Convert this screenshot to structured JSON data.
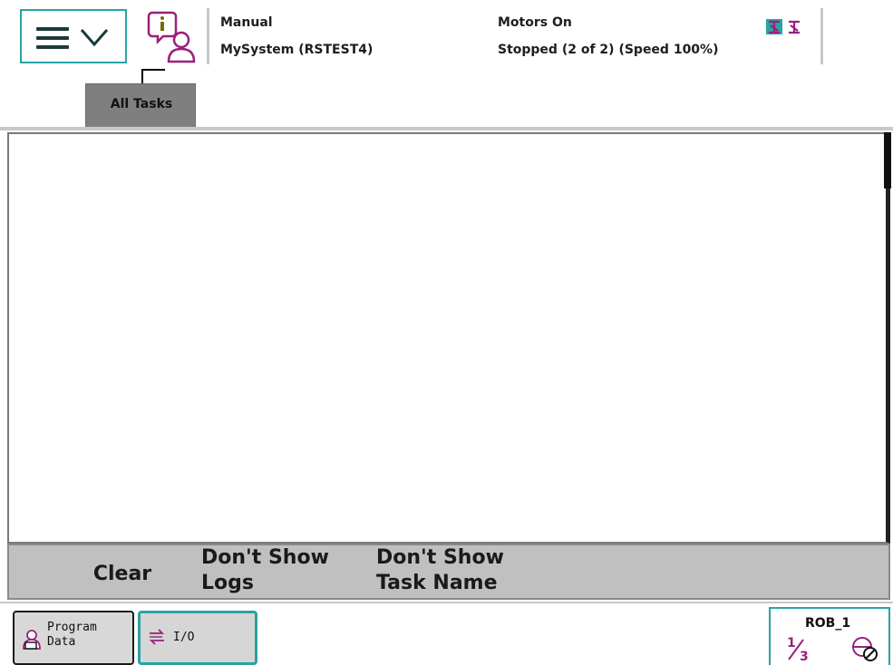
{
  "colors": {
    "accent": "#2aa3a3",
    "icon_magenta": "#9b1f7b",
    "panel_gray": "#c0c0c0",
    "tab_gray": "#7f7f7f"
  },
  "header": {
    "menu_icon": "hamburger-chevron-icon",
    "info_icon": "operator-info-icon",
    "mode": "Manual",
    "system": "MySystem (RSTEST4)",
    "motors": "Motors On",
    "run_state": "Stopped (2 of 2) (Speed 100%)",
    "status_icons": [
      "robot-status-icon",
      "robot-status-icon-2"
    ]
  },
  "tabs": [
    {
      "label": "All Tasks"
    }
  ],
  "actions": {
    "clear": "Clear",
    "logs_line1": "Don't Show",
    "logs_line2": "Logs",
    "task_line1": "Don't Show",
    "task_line2": "Task Name"
  },
  "taskbar": {
    "program_data_line1": "Program",
    "program_data_line2": "Data",
    "program_data_icon": "program-data-icon",
    "io_label": "I/O",
    "io_icon": "io-arrows-icon",
    "robot_label": "ROB_1",
    "fraction": "1/3",
    "speed_icon": "speed-off-icon"
  }
}
